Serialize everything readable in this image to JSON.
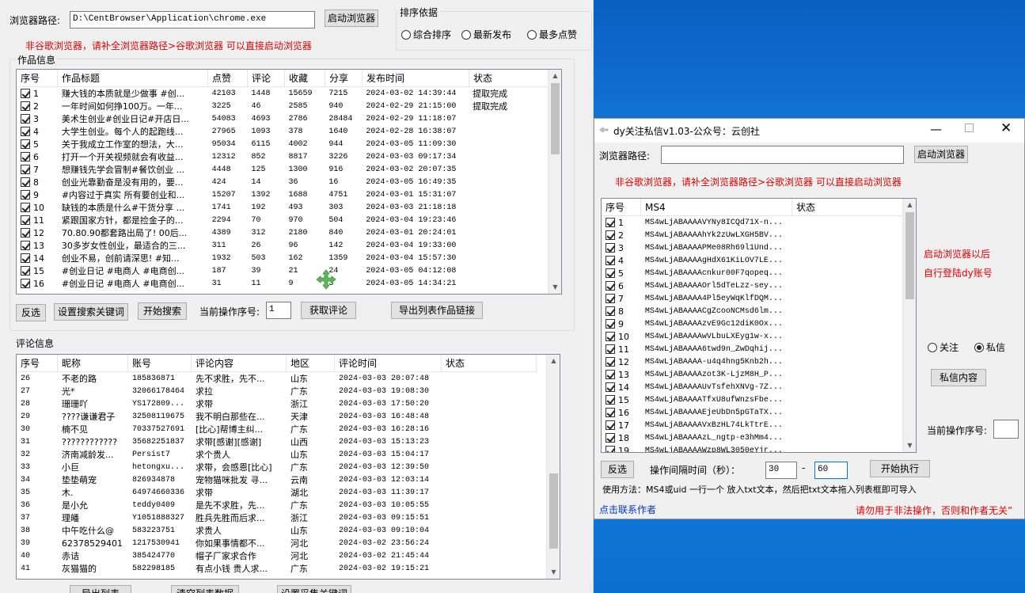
{
  "main": {
    "browser_path_label": "浏览器路径:",
    "browser_path_value": "D:\\CentBrowser\\Application\\chrome.exe",
    "launch_browser": "启动浏览器",
    "warning": "非谷歌浏览器，请补全浏览器路径>谷歌浏览器 可以直接启动浏览器",
    "sort": {
      "title": "排序依据",
      "options": [
        "综合排序",
        "最新发布",
        "最多点赞"
      ]
    },
    "works": {
      "title": "作品信息",
      "columns": [
        "序号",
        "作品标题",
        "点赞",
        "评论",
        "收藏",
        "分享",
        "发布时间",
        "状态"
      ],
      "rows": [
        [
          "1",
          "赚大钱的本质就是少做事 #创...",
          "42103",
          "1448",
          "15659",
          "7215",
          "2024-03-02 14:39:44",
          "提取完成"
        ],
        [
          "2",
          "一年时间如何挣100万。一年...",
          "3225",
          "46",
          "2585",
          "940",
          "2024-02-29 21:15:00",
          "提取完成"
        ],
        [
          "3",
          "美术生创业#创业日记#开店日...",
          "54083",
          "4693",
          "2786",
          "28484",
          "2024-02-29 11:18:07",
          ""
        ],
        [
          "4",
          "大学生创业。每个人的起跑线...",
          "27965",
          "1093",
          "378",
          "1640",
          "2024-02-28 16:38:07",
          ""
        ],
        [
          "5",
          "关于我成立工作室的想法，大...",
          "95034",
          "6115",
          "4002",
          "944",
          "2024-03-05 11:09:30",
          ""
        ],
        [
          "6",
          "打开一个开关视频就会有收益...",
          "12312",
          "852",
          "8817",
          "3226",
          "2024-03-03 09:17:34",
          ""
        ],
        [
          "7",
          "想赚钱先学会冒制#餐饮创业 ...",
          "4448",
          "125",
          "1300",
          "916",
          "2024-03-02 20:07:35",
          ""
        ],
        [
          "8",
          "创业光靠勤奋是没有用的，要...",
          "424",
          "14",
          "36",
          "16",
          "2024-03-05 16:49:35",
          ""
        ],
        [
          "9",
          "#内容过于真实 所有要创业和...",
          "15207",
          "1392",
          "1688",
          "4751",
          "2024-03-01 15:31:07",
          ""
        ],
        [
          "10",
          "缺钱的本质是什么#干货分享 ...",
          "1741",
          "192",
          "493",
          "303",
          "2024-03-03 21:18:18",
          ""
        ],
        [
          "11",
          "紧跟国家方针，都是捡金子的...",
          "2294",
          "70",
          "970",
          "504",
          "2024-03-04 19:23:46",
          ""
        ],
        [
          "12",
          "70.80.90都套路出局了! 00后...",
          "4389",
          "312",
          "2180",
          "840",
          "2024-03-01 20:24:01",
          ""
        ],
        [
          "13",
          "30多岁女性创业，最适合的三...",
          "311",
          "26",
          "96",
          "142",
          "2024-03-04 19:33:00",
          ""
        ],
        [
          "14",
          "创业不易，创前请深思! #知...",
          "1932",
          "503",
          "162",
          "1359",
          "2024-03-04 15:57:30",
          ""
        ],
        [
          "15",
          "#创业日记 #电商人 #电商创...",
          "187",
          "39",
          "21",
          "24",
          "2024-03-05 04:12:08",
          ""
        ],
        [
          "16",
          "#创业日记 #电商人 #电商创...",
          "31",
          "11",
          "9",
          "3",
          "2024-03-05 14:34:21",
          ""
        ]
      ]
    },
    "toolbar1": {
      "invert": "反选",
      "set_keywords": "设置搜索关键词",
      "start_search": "开始搜索",
      "current_op_label": "当前操作序号:",
      "current_op_value": "1",
      "get_comments": "获取评论",
      "export_links": "导出列表作品链接"
    },
    "comments": {
      "title": "评论信息",
      "columns": [
        "序号",
        "昵称",
        "账号",
        "评论内容",
        "地区",
        "评论时间",
        "状态"
      ],
      "rows": [
        [
          "26",
          "不老的路",
          "185836871",
          "先不求胜，先不...",
          "山东",
          "2024-03-03 20:07:48",
          ""
        ],
        [
          "27",
          "光*",
          "32066178464",
          "求拉",
          "广东",
          "2024-03-03 19:08:30",
          ""
        ],
        [
          "28",
          "珊珊吖",
          "YS172809...",
          "求带",
          "浙江",
          "2024-03-03 17:50:20",
          ""
        ],
        [
          "29",
          "????谦谦君子",
          "32508119675",
          "我不明白那些在...",
          "天津",
          "2024-03-03 16:48:48",
          ""
        ],
        [
          "30",
          "楠不见",
          "70337527691",
          "[比心]帮博主纠...",
          "广东",
          "2024-03-03 16:28:16",
          ""
        ],
        [
          "31",
          "????????????",
          "35682251837",
          "求带[感谢][感谢]",
          "山西",
          "2024-03-03 15:13:23",
          ""
        ],
        [
          "32",
          "济南减龄发...",
          "Persist7",
          "求个贵人",
          "山东",
          "2024-03-03 15:04:17",
          ""
        ],
        [
          "33",
          "小巨",
          "hetongxu...",
          "求带，会感恩[比心]",
          "广东",
          "2024-03-03 12:39:50",
          ""
        ],
        [
          "34",
          "垫垫萌宠",
          "826934878",
          "宠物猫咪批发 寻...",
          "云南",
          "2024-03-03 12:03:14",
          ""
        ],
        [
          "35",
          "木.",
          "64974660336",
          "求带",
          "湖北",
          "2024-03-03 11:39:17",
          ""
        ],
        [
          "36",
          "是小允",
          "teddy0409",
          "是先不求胜，先...",
          "广东",
          "2024-03-03 10:05:55",
          ""
        ],
        [
          "37",
          "理皤",
          "Y1051888327",
          "胜兵先胜而后求...",
          "浙江",
          "2024-03-03 09:15:51",
          ""
        ],
        [
          "38",
          "中午吃什么@",
          "583223751",
          "求贵人",
          "山东",
          "2024-03-03 09:10:04",
          ""
        ],
        [
          "39",
          "62378529401",
          "1217530941",
          "你如果事情都不...",
          "河北",
          "2024-03-02 23:56:24",
          ""
        ],
        [
          "40",
          "赤诘",
          "385424770",
          "帽子厂家求合作",
          "河北",
          "2024-03-02 21:45:44",
          ""
        ],
        [
          "41",
          "灰猫猫的",
          "582298185",
          "有点小钱 贵人求...",
          "广东",
          "2024-03-02 19:15:21",
          ""
        ]
      ]
    },
    "toolbar2": {
      "export_list": "导出列表",
      "clear_data": "清空列表数据",
      "set_filter": "设置采集关键词"
    }
  },
  "dm": {
    "title": "dy关注私信v1.03-公众号：云创社",
    "browser_path_label": "浏览器路径:",
    "browser_path_value": "",
    "launch_browser": "启动浏览器",
    "warning": "非谷歌浏览器，请补全浏览器路径>谷歌浏览器 可以直接启动浏览器",
    "columns": [
      "序号",
      "MS4",
      "状态"
    ],
    "rows": [
      [
        "1",
        "MS4wLjABAAAAVYNy8ICQd71X-n..."
      ],
      [
        "2",
        "MS4wLjABAAAAhYk2zUwLXGH5BV..."
      ],
      [
        "3",
        "MS4wLjABAAAAPMe08Rh69l1Und..."
      ],
      [
        "4",
        "MS4wLjABAAAAgHdX61KiLOV7LE..."
      ],
      [
        "5",
        "MS4wLjABAAAAcnkur00F7qopeq..."
      ],
      [
        "6",
        "MS4wLjABAAAAOrl5dTeLzz-sey..."
      ],
      [
        "7",
        "MS4wLjABAAAA4Pl5eyWqKlfDQM..."
      ],
      [
        "8",
        "MS4wLjABAAAACgZcooNCMsd6lm..."
      ],
      [
        "9",
        "MS4wLjABAAAAzvE9Gc12diK0Ox..."
      ],
      [
        "10",
        "MS4wLjABAAAAwVLbuLXEyg1w-x..."
      ],
      [
        "11",
        "MS4wLjABAAAA6twd9n_ZwDqhij..."
      ],
      [
        "12",
        "MS4wLjABAAAA-u4q4hng5Knb2h..."
      ],
      [
        "13",
        "MS4wLjABAAAAzot3K-LjzM8H_P..."
      ],
      [
        "14",
        "MS4wLjABAAAAUvTsfehXNVg-7Z..."
      ],
      [
        "15",
        "MS4wLjABAAAATfxU8ufWnzsFbe..."
      ],
      [
        "16",
        "MS4wLjABAAAAEjeUbDn5pGTaTX..."
      ],
      [
        "17",
        "MS4wLjABAAAAVxBzHL74LkTtrE..."
      ],
      [
        "18",
        "MS4wLjABAAAAzL_ngtp-e3hMm4..."
      ],
      [
        "19",
        "MS4wLjABAAAAWzp8WL3050eYjr..."
      ]
    ],
    "hint_line1": "启动浏览器以后",
    "hint_line2": "自行登陆dy账号",
    "follow": "关注",
    "message": "私信",
    "dm_content": "私信内容",
    "current_op_label": "当前操作序号:",
    "current_op_value": "",
    "invert": "反选",
    "interval_label": "操作间隔时间（秒）：",
    "interval_from": "30",
    "dash": "-",
    "interval_to": "60",
    "start": "开始执行",
    "usage": "使用方法：MS4或uid 一行一个 放入txt文本，然后把txt文本拖入列表框即可导入",
    "contact": "点击联系作者",
    "disclaimer": "请勿用于非法操作，否则和作者无关”"
  },
  "colors": {
    "warning_red": "#e00000",
    "link_blue": "#0033cc",
    "desktop_blue": "#0a6fd0",
    "cursor_green": "#5cb85c"
  }
}
